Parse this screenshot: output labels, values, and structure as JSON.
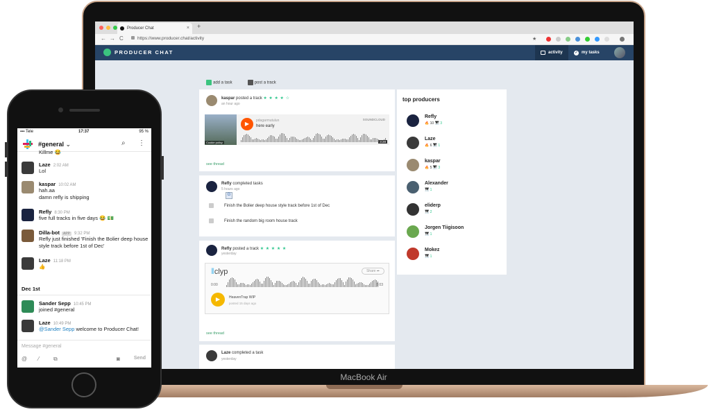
{
  "browser": {
    "tab_title": "Producer Chat",
    "tab_close": "×",
    "new_tab": "+",
    "url": "https://www.producer.chat/activity",
    "back": "←",
    "forward": "→",
    "reload": "C",
    "bookmark": "★"
  },
  "app": {
    "logo": "PRODUCER CHAT",
    "nav": [
      {
        "label": "activity"
      },
      {
        "label": "my tasks"
      }
    ]
  },
  "feed": {
    "actions": [
      {
        "label": "add a task"
      },
      {
        "label": "post a track"
      }
    ],
    "posts": [
      {
        "user": "kaspar",
        "verb": "posted a track",
        "stars": "★ ★ ★ ★ ☆",
        "time": "an hour ago",
        "embed": {
          "user": "pdagarmutulun",
          "title": "here early",
          "brand": "SOUNDCLOUD",
          "cookie": "Cookie policy",
          "duration": "3:28"
        },
        "see_thread": "see thread"
      },
      {
        "user": "Refly",
        "verb": "completed tasks",
        "time": "5 hours ago",
        "tasks": [
          "Finish the Bolier deep house style track before 1st of Dec",
          "Finish the random big room house track"
        ]
      },
      {
        "user": "Refly",
        "verb": "posted a track",
        "stars": "★ ★ ★ ★ ★",
        "time": "yesterday",
        "embed": {
          "brand": "clyp",
          "share": "Share ➦",
          "start": "0:00",
          "end": "1:03",
          "title": "HeavenTrap WIP",
          "time": "posted 15 days ago"
        },
        "see_thread": "see thread"
      },
      {
        "user": "Laze",
        "verb": "completed a task",
        "time": "yesterday"
      }
    ]
  },
  "top_producers": {
    "title": "top producers",
    "items": [
      {
        "name": "Refly",
        "fire": "10",
        "tracks": "3",
        "color": "#1a2340"
      },
      {
        "name": "Laze",
        "fire": "6",
        "tracks": "1",
        "color": "#3a3a3a"
      },
      {
        "name": "kaspar",
        "fire": "5",
        "tracks": "3",
        "color": "#9a8a70"
      },
      {
        "name": "Alexander",
        "fire": "",
        "tracks": "1",
        "color": "#4a6070"
      },
      {
        "name": "eliderp",
        "fire": "",
        "tracks": "2",
        "color": "#333333"
      },
      {
        "name": "Jorgen Tiigisoon",
        "fire": "",
        "tracks": "1",
        "color": "#6aa84f"
      },
      {
        "name": "Mokez",
        "fire": "",
        "tracks": "1",
        "color": "#c0392b"
      }
    ]
  },
  "macbook": {
    "label": "MacBook Air"
  },
  "phone": {
    "status": {
      "carrier": "▪▪▪ Tele",
      "time": "17:37",
      "battery": "95 %"
    },
    "channel": "#general",
    "channel_caret": "⌄",
    "messages": [
      {
        "name": "",
        "time": "",
        "text": "Killme 😂",
        "color": "#ffffff"
      },
      {
        "name": "Laze",
        "time": "2:02 AM",
        "text": "Lol",
        "color": "#3a3a3a"
      },
      {
        "name": "kaspar",
        "time": "10:02 AM",
        "text": "hah.aa",
        "text2": "damn refly is shipping",
        "color": "#9a8a70"
      },
      {
        "name": "Refly",
        "time": "8:30 PM",
        "text": "five full tracks in five days 😂 💵",
        "color": "#1a2340"
      },
      {
        "name": "Dilla-bot",
        "badge": "APP",
        "time": "9:32 PM",
        "text": "Refly just finished 'Finish the Bolier deep house style track before 1st of Dec'",
        "color": "#7a5a3a"
      },
      {
        "name": "Laze",
        "time": "11:18 PM",
        "text": "👍",
        "color": "#3a3a3a"
      }
    ],
    "day": "Dec 1st",
    "messages2": [
      {
        "name": "Sander Sepp",
        "time": "10:45 PM",
        "text": "joined #general",
        "color": "#2e8b57"
      },
      {
        "name": "Laze",
        "time": "10:49 PM",
        "mention": "@Sander Sepp",
        "text": " welcome to Producer Chat!",
        "color": "#3a3a3a"
      }
    ],
    "compose": {
      "placeholder": "Message #general",
      "send": "Send"
    }
  }
}
